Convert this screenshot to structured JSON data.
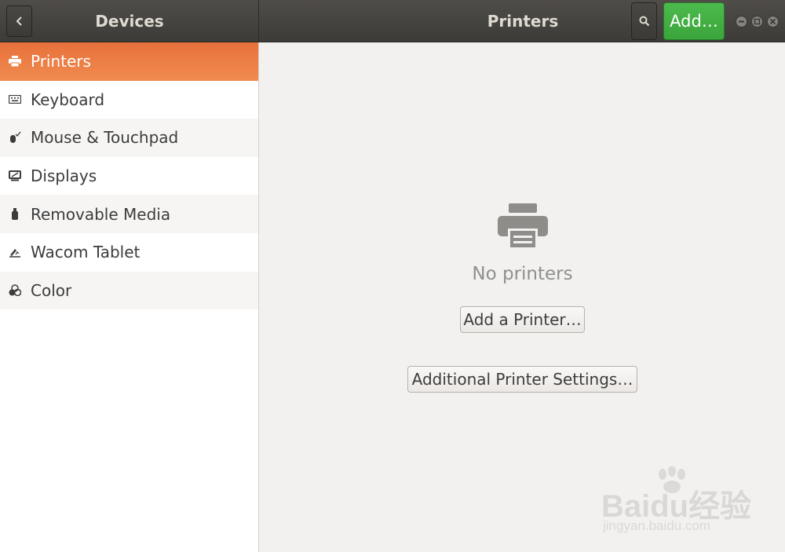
{
  "header": {
    "left_title": "Devices",
    "main_title": "Printers",
    "add_label": "Add…",
    "icons": {
      "back": "chevron-left-icon",
      "search": "search-icon",
      "minimize": "minimize-icon",
      "maximize": "maximize-icon",
      "close": "close-icon"
    }
  },
  "sidebar": {
    "items": [
      {
        "label": "Printers",
        "icon": "printer-icon",
        "active": true
      },
      {
        "label": "Keyboard",
        "icon": "keyboard-icon",
        "active": false
      },
      {
        "label": "Mouse & Touchpad",
        "icon": "mouse-icon",
        "active": false
      },
      {
        "label": "Displays",
        "icon": "display-icon",
        "active": false
      },
      {
        "label": "Removable Media",
        "icon": "usb-drive-icon",
        "active": false
      },
      {
        "label": "Wacom Tablet",
        "icon": "tablet-pen-icon",
        "active": false
      },
      {
        "label": "Color",
        "icon": "color-icon",
        "active": false
      }
    ]
  },
  "main": {
    "empty_icon": "printer-icon",
    "empty_label": "No printers",
    "add_printer_label": "Add a Printer…",
    "additional_settings_label": "Additional Printer Settings…"
  },
  "watermark": {
    "main": "Baidu经验",
    "sub": "jingyan.baidu.com"
  },
  "colors": {
    "accent": "#e9713c",
    "add_button": "#3fae3f",
    "header": "#45433f"
  }
}
